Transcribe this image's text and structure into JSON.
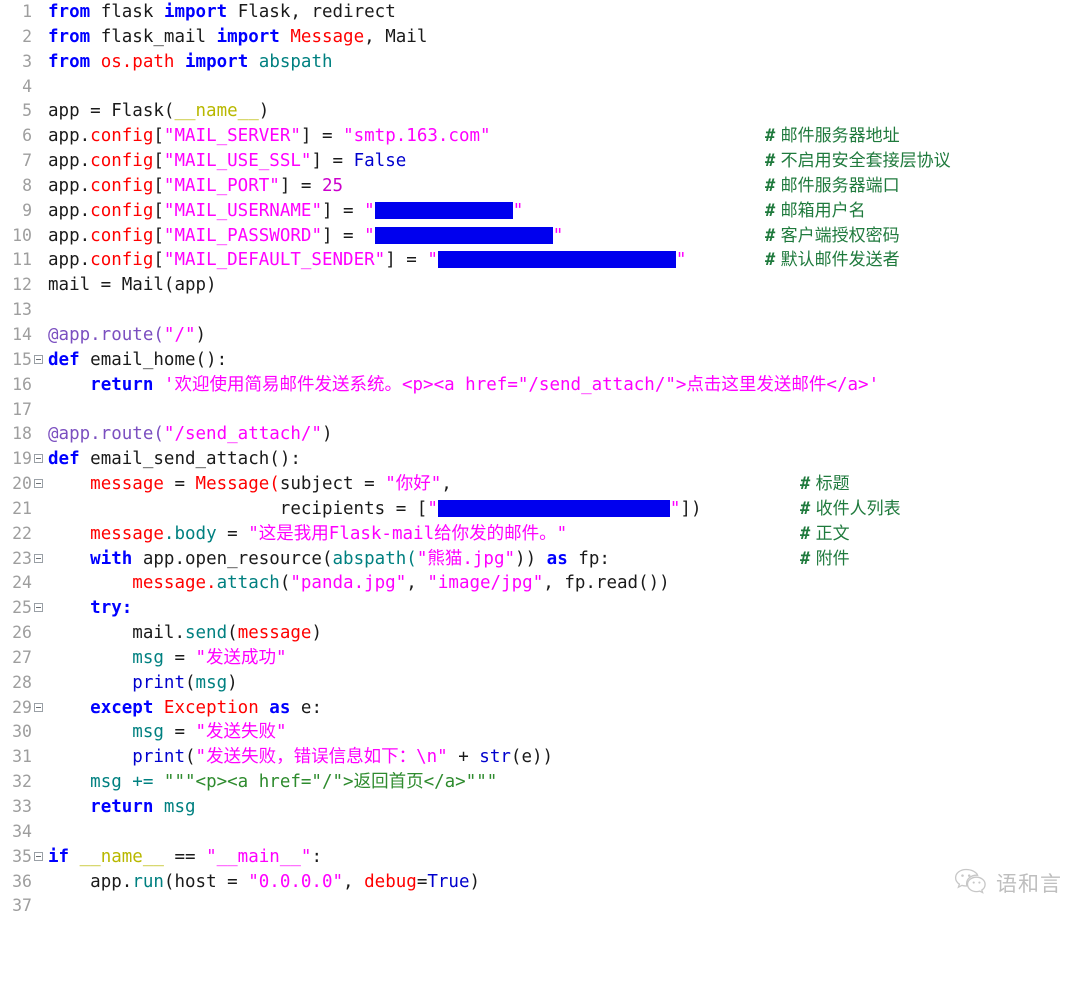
{
  "editor": {
    "language": "python",
    "total_lines": 37,
    "background": "#ffffff",
    "gutter_color": "#9e9e9e",
    "comment_color": "#1f7a3d",
    "redaction_color": "#0000ee",
    "lines": [
      {
        "n": "1",
        "fold": false
      },
      {
        "n": "2",
        "fold": false
      },
      {
        "n": "3",
        "fold": false
      },
      {
        "n": "4",
        "fold": false
      },
      {
        "n": "5",
        "fold": false
      },
      {
        "n": "6",
        "fold": false
      },
      {
        "n": "7",
        "fold": false
      },
      {
        "n": "8",
        "fold": false
      },
      {
        "n": "9",
        "fold": false
      },
      {
        "n": "10",
        "fold": false
      },
      {
        "n": "11",
        "fold": false
      },
      {
        "n": "12",
        "fold": false
      },
      {
        "n": "13",
        "fold": false
      },
      {
        "n": "14",
        "fold": false
      },
      {
        "n": "15",
        "fold": true
      },
      {
        "n": "16",
        "fold": false
      },
      {
        "n": "17",
        "fold": false
      },
      {
        "n": "18",
        "fold": false
      },
      {
        "n": "19",
        "fold": true
      },
      {
        "n": "20",
        "fold": true
      },
      {
        "n": "21",
        "fold": false
      },
      {
        "n": "22",
        "fold": false
      },
      {
        "n": "23",
        "fold": true
      },
      {
        "n": "24",
        "fold": false
      },
      {
        "n": "25",
        "fold": true
      },
      {
        "n": "26",
        "fold": false
      },
      {
        "n": "27",
        "fold": false
      },
      {
        "n": "28",
        "fold": false
      },
      {
        "n": "29",
        "fold": true
      },
      {
        "n": "30",
        "fold": false
      },
      {
        "n": "31",
        "fold": false
      },
      {
        "n": "32",
        "fold": false
      },
      {
        "n": "33",
        "fold": false
      },
      {
        "n": "34",
        "fold": false
      },
      {
        "n": "35",
        "fold": true
      },
      {
        "n": "36",
        "fold": false
      },
      {
        "n": "37",
        "fold": false
      }
    ],
    "code": {
      "l1": "from flask import Flask, redirect",
      "l2": "from flask_mail import Message, Mail",
      "l3": "from os.path import abspath",
      "l4": "",
      "l5": "app = Flask(__name__)",
      "l6": "app.config[\"MAIL_SERVER\"] = \"smtp.163.com\"",
      "l7": "app.config[\"MAIL_USE_SSL\"] = False",
      "l8": "app.config[\"MAIL_PORT\"] = 25",
      "l9": "app.config[\"MAIL_USERNAME\"] = \"\"",
      "l10": "app.config[\"MAIL_PASSWORD\"] = \"\"",
      "l11": "app.config[\"MAIL_DEFAULT_SENDER\"] = \"\"",
      "l12": "mail = Mail(app)",
      "l13": "",
      "l14": "@app.route(\"/\")",
      "l15": "def email_home():",
      "l16": "    return '欢迎使用简易邮件发送系统。<p><a href=\"/send_attach/\">点击这里发送邮件</a>'",
      "l17": "",
      "l18": "@app.route(\"/send_attach/\")",
      "l19": "def email_send_attach():",
      "l20": "    message = Message(subject = \"你好\",",
      "l21": "                      recipients = [\"\"])",
      "l22": "    message.body = \"这是我用Flask-mail给你发的邮件。\"",
      "l23": "    with app.open_resource(abspath(\"熊猫.jpg\")) as fp:",
      "l24": "        message.attach(\"panda.jpg\", \"image/jpg\", fp.read())",
      "l25": "    try:",
      "l26": "        mail.send(message)",
      "l27": "        msg = \"发送成功\"",
      "l28": "        print(msg)",
      "l29": "    except Exception as e:",
      "l30": "        msg = \"发送失败\"",
      "l31": "        print(\"发送失败，错误信息如下：\\n\" + str(e))",
      "l32": "    msg += \"\"\"<p><a href=\"/\">返回首页</a>\"\"\"",
      "l33": "    return msg",
      "l34": "",
      "l35": "if __name__ == \"__main__\":",
      "l36": "    app.run(host = \"0.0.0.0\", debug=True)",
      "l37": ""
    },
    "tokens": {
      "from": "from",
      "import": "import",
      "flask": "flask",
      "Flask": "Flask",
      "comma_redirect": ", redirect",
      "flask_mail": "flask_mail",
      "Message": "Message",
      "comma_Mail": ", Mail",
      "os_path": "os.path",
      "abspath": "abspath",
      "app_eq": "app = ",
      "Flask_open": "Flask(",
      "dunder_name": "__name__",
      "paren_close": ")",
      "app_dot": "app.",
      "config": "config",
      "bracket_open": "[",
      "q": "\"",
      "MAIL_SERVER": "MAIL_SERVER",
      "MAIL_USE_SSL": "MAIL_USE_SSL",
      "MAIL_PORT": "MAIL_PORT",
      "MAIL_USERNAME": "MAIL_USERNAME",
      "MAIL_PASSWORD": "MAIL_PASSWORD",
      "MAIL_DEFAULT_SENDER": "MAIL_DEFAULT_SENDER",
      "bracket_close_eq": "] = ",
      "smtp_host": "\"smtp.163.com\"",
      "False": "False",
      "True": "True",
      "n25": "25",
      "mail_eq": "mail = ",
      "Mail_open": "Mail(",
      "app_close": "app)",
      "route_dec": "@app.route(",
      "route_root": "\"/\"",
      "route_send": "\"/send_attach/\"",
      "def": "def",
      "email_home": "email_home",
      "email_send_attach": "email_send_attach",
      "parens_colon": "():",
      "return": "return",
      "home_html": "'欢迎使用简易邮件发送系统。<p><a href=\"/send_attach/\">点击这里发送邮件</a>'",
      "message": "message",
      "eq_space": " = ",
      "Message_open": "Message(",
      "subject_eq": "subject = ",
      "nihao": "\"你好\"",
      "trailing_comma": ",",
      "recipients_eq": "recipients = [",
      "close_bracket_paren": "])",
      "dot_body": ".body",
      "body_text": "\"这是我用Flask-mail给你发的邮件。\"",
      "with": "with",
      "open_resource": "app.open_resource(",
      "abspath_open": "abspath(",
      "panda_cn": "\"熊猫.jpg\"",
      "close_close": "))",
      "as": "as",
      "fp_colon": "fp:",
      "message_dot": "message.",
      "attach": "attach",
      "panda_jpg": "\"panda.jpg\"",
      "image_jpg": "\"image/jpg\"",
      "fp_read": "fp.read())",
      "try_colon": "try:",
      "mail_dot": "mail.",
      "send": "send",
      "msg": "msg",
      "send_ok": "\"发送成功\"",
      "send_fail": "\"发送失败\"",
      "print": "print",
      "except": "except",
      "Exception": "Exception",
      "e_colon": "e:",
      "fail_msg": "\"发送失败，错误信息如下：\\n\"",
      "plus": " + ",
      "str_fn": "str",
      "e_close": "(e))",
      "msg_pluseq": "msg += ",
      "back_home": "\"\"\"<p><a href=\"/\">返回首页</a>\"\"\"",
      "if": "if",
      "dunder_main": "\"__main__\"",
      "eqeq": " == ",
      "colon": ":",
      "app_run": "app.",
      "run": "run",
      "host_eq": "(host = ",
      "host_ip": "\"0.0.0.0\"",
      "debug": "debug",
      "eq_true": "=",
      "paren_end": ")"
    },
    "comments": [
      {
        "line": 6,
        "hash": "#",
        "text": "邮件服务器地址"
      },
      {
        "line": 7,
        "hash": "#",
        "text": "不启用安全套接层协议"
      },
      {
        "line": 8,
        "hash": "#",
        "text": "邮件服务器端口"
      },
      {
        "line": 9,
        "hash": "#",
        "text": "邮箱用户名"
      },
      {
        "line": 10,
        "hash": "#",
        "text": "客户端授权密码"
      },
      {
        "line": 11,
        "hash": "#",
        "text": "默认邮件发送者"
      },
      {
        "line": 20,
        "hash": "#",
        "text": "标题"
      },
      {
        "line": 21,
        "hash": "#",
        "text": "收件人列表"
      },
      {
        "line": 22,
        "hash": "#",
        "text": "正文"
      },
      {
        "line": 23,
        "hash": "#",
        "text": "附件"
      }
    ],
    "redactions": [
      {
        "line": 9,
        "label": "redacted-mail-username"
      },
      {
        "line": 10,
        "label": "redacted-mail-password"
      },
      {
        "line": 11,
        "label": "redacted-mail-default-sender"
      },
      {
        "line": 21,
        "label": "redacted-recipient-address"
      }
    ]
  },
  "watermark": {
    "icon": "wechat-icon",
    "text": "语和言"
  }
}
